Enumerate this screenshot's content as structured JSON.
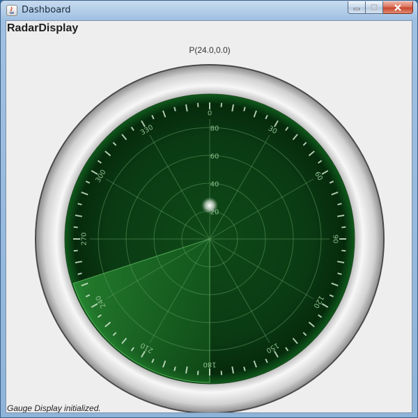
{
  "window": {
    "title": "Dashboard",
    "icon": "java-icon"
  },
  "header": {
    "title": "RadarDisplay"
  },
  "gauge": {
    "label": "P(24.0,0.0)",
    "blip": {
      "distance": 24.0,
      "angle": 0.0
    },
    "range_labels": [
      "20",
      "40",
      "60",
      "80"
    ],
    "angle_labels": [
      "0",
      "30",
      "60",
      "90",
      "120",
      "150",
      "180",
      "210",
      "240",
      "270",
      "300",
      "330"
    ],
    "sweep_from_deg": 252,
    "sweep_to_deg": 180,
    "colors": {
      "screen": "#0a3a12",
      "grid": "#5f9a62",
      "label": "#8fbf8f",
      "sweep": "#5fcf5f",
      "bezel_dark": "#5a5a5a",
      "bezel_light": "#f4f4f4"
    }
  },
  "status": {
    "text": "Gauge Display initialized."
  }
}
